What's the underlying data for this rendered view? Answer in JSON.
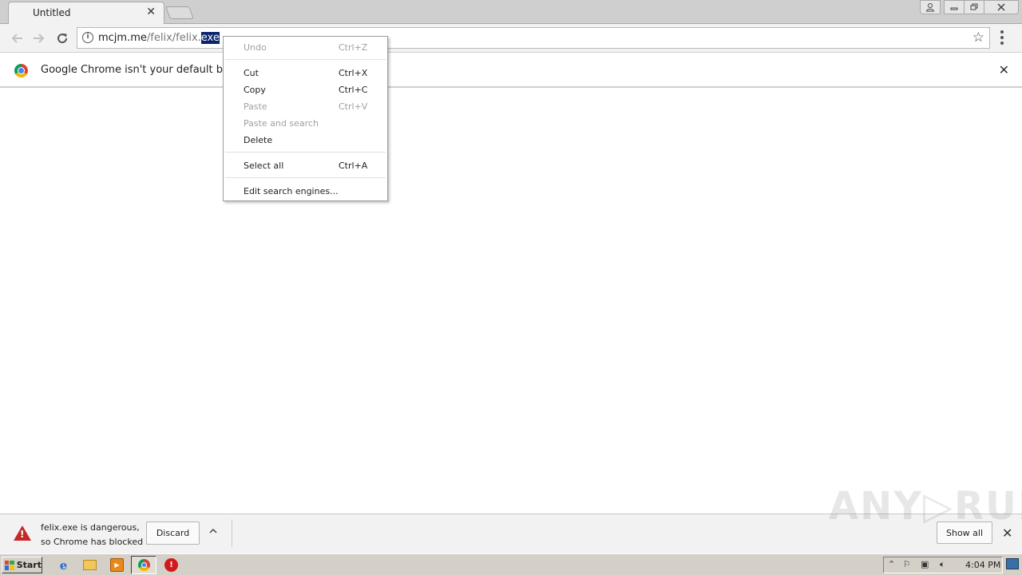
{
  "browser": {
    "tab_title": "Untitled",
    "tab_close_glyph": "✕",
    "url_host": "mcjm.me",
    "url_path": "/felix/felix.",
    "url_selected": "exe"
  },
  "infobar": {
    "message": "Google Chrome isn't your default browser",
    "close_glyph": "✕"
  },
  "context_menu": {
    "items": [
      {
        "label": "Undo",
        "shortcut": "Ctrl+Z",
        "enabled": false
      },
      {
        "label": "Cut",
        "shortcut": "Ctrl+X",
        "enabled": true
      },
      {
        "label": "Copy",
        "shortcut": "Ctrl+C",
        "enabled": true
      },
      {
        "label": "Paste",
        "shortcut": "Ctrl+V",
        "enabled": false
      },
      {
        "label": "Paste and search",
        "shortcut": "",
        "enabled": false
      },
      {
        "label": "Delete",
        "shortcut": "",
        "enabled": true
      },
      {
        "label": "Select all",
        "shortcut": "Ctrl+A",
        "enabled": true
      },
      {
        "label": "Edit search engines...",
        "shortcut": "",
        "enabled": true
      }
    ]
  },
  "download_shelf": {
    "line1": "felix.exe is dangerous,",
    "line2": "so Chrome has blocked it.",
    "discard_label": "Discard",
    "show_all_label": "Show all"
  },
  "watermark": "ANY▷RUN",
  "taskbar": {
    "start_label": "Start",
    "clock": "4:04 PM"
  },
  "colors": {
    "selection": "#0a246a",
    "danger": "#c62828",
    "taskbar": "#d4d0c8"
  }
}
